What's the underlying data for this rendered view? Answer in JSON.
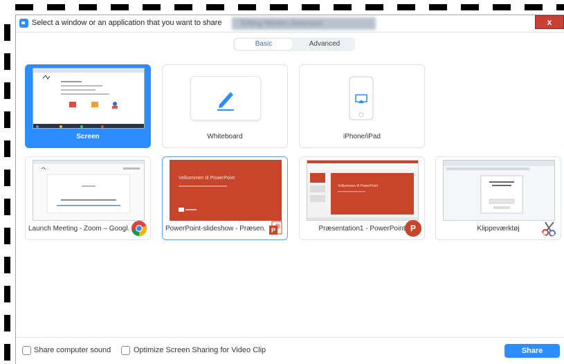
{
  "dialog": {
    "title": "Select a window or an application that you want to share",
    "blurred_name": "Tofting Morten Sorensen",
    "close_symbol": "x"
  },
  "tabs": [
    {
      "label": "Basic",
      "active": true
    },
    {
      "label": "Advanced",
      "active": false
    }
  ],
  "cards": [
    {
      "label": "Screen",
      "selected": true
    },
    {
      "label": "Whiteboard"
    },
    {
      "label": "iPhone/iPad"
    },
    {
      "label": "Launch Meeting - Zoom – Googl...",
      "app_icon": "chrome-icon"
    },
    {
      "label": "PowerPoint-slideshow  -  Præsen...",
      "app_icon": "powerpoint-slideshow-icon",
      "slide_title": "Velkommen til PowerPoint"
    },
    {
      "label": "Præsentation1 - PowerPoint",
      "app_icon": "powerpoint-icon",
      "slide_title": "Velkommen til PowerPoint",
      "badge": "P"
    },
    {
      "label": "Klippeværktøj",
      "app_icon": "scissors-icon"
    }
  ],
  "bottom": {
    "share_sound_label": "Share computer sound",
    "optimize_label": "Optimize Screen Sharing for Video Clip",
    "share_button": "Share"
  },
  "colors": {
    "accent": "#2d8cff",
    "powerpoint": "#c8442b",
    "close": "#c94035"
  }
}
